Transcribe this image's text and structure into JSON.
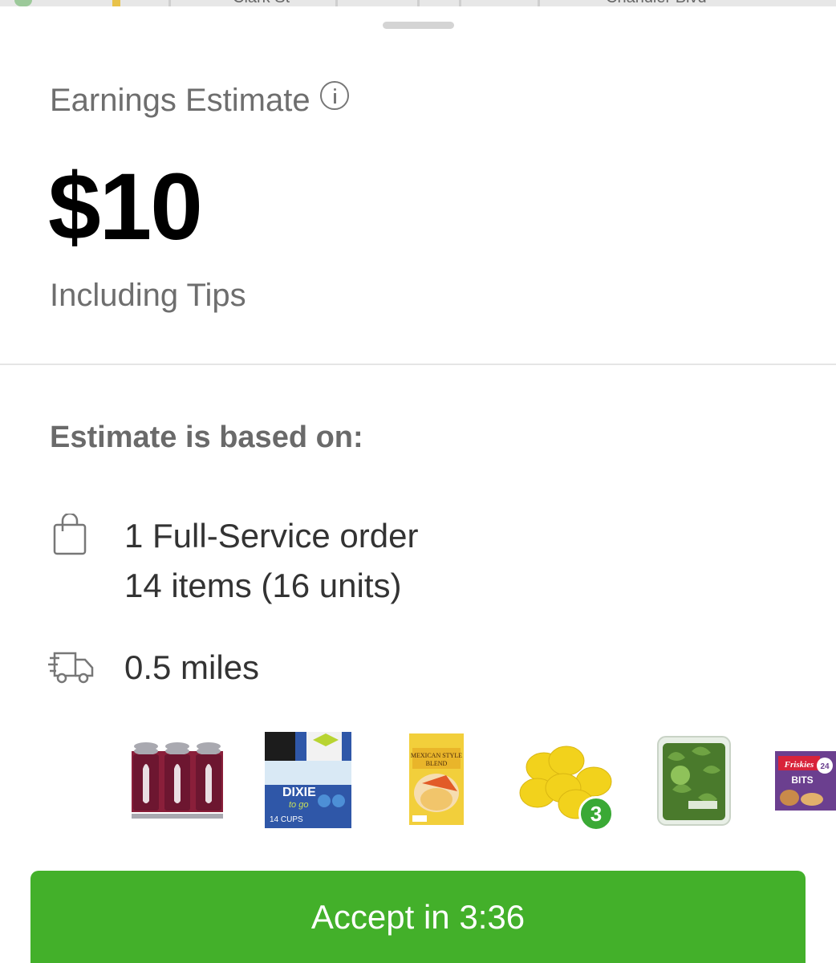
{
  "map": {
    "street_left": "Clark St",
    "street_right": "Chandler Blvd"
  },
  "earnings": {
    "label": "Earnings Estimate",
    "amount": "$10",
    "subtext": "Including Tips"
  },
  "basis": {
    "heading": "Estimate is based on:",
    "order_line_1": "1 Full-Service order",
    "order_line_2": "14 items (16 units)",
    "distance": "0.5 miles"
  },
  "products": [
    {
      "name": "cola-six-pack"
    },
    {
      "name": "dixie-to-go-cups",
      "text": "DIXIE to go"
    },
    {
      "name": "mexican-style-cheese",
      "text": "MEXICAN STYLE BLEND"
    },
    {
      "name": "lemons",
      "quantity": "3"
    },
    {
      "name": "baby-arugula"
    },
    {
      "name": "friskies-bits",
      "text": "Friskies BITS"
    }
  ],
  "accept_button": {
    "label": "Accept in 3:36"
  },
  "colors": {
    "accent": "#43b02a",
    "badge": "#3aa935",
    "muted_text": "#6e6e6e"
  }
}
